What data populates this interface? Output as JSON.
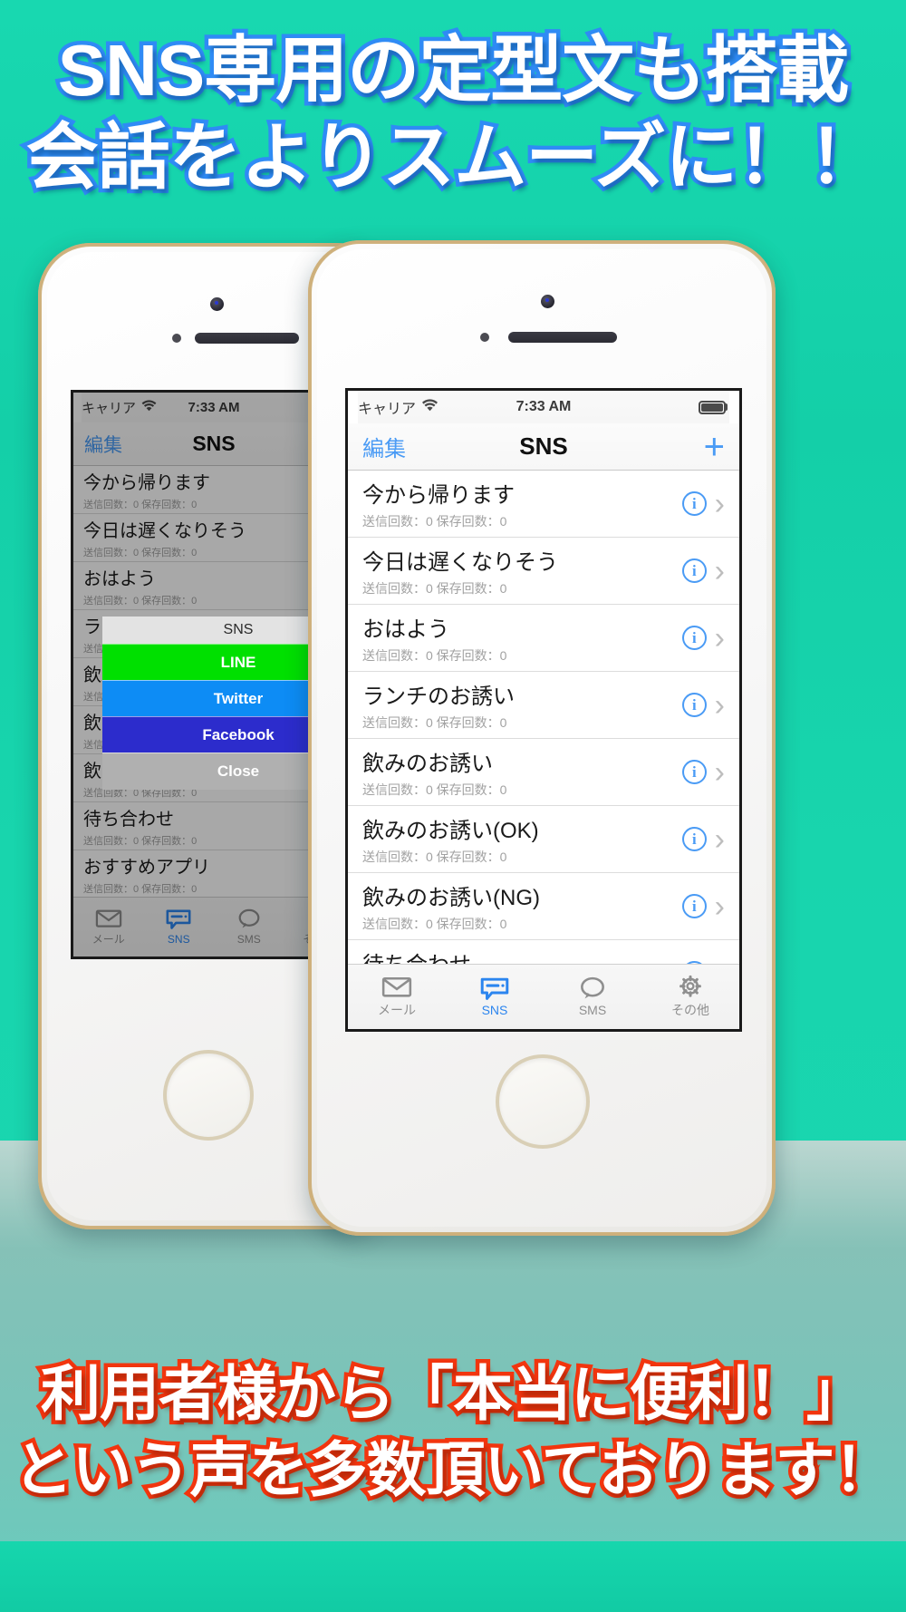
{
  "headline": {
    "line1": "SNS専用の定型文も搭載",
    "line2": "会話をよりスムーズに！！",
    "text_color": "#ffffff",
    "outline_color": "#2f8bf5"
  },
  "caption": {
    "line1": "利用者様から「本当に便利！」",
    "line2": "という声を多数頂いております！",
    "text_color": "#ffffff",
    "outline_color": "#f2350e"
  },
  "background": {
    "top_color": "#18d8b0",
    "bottom_band_color": "#16d6ad",
    "table_color": "#96bdb8"
  },
  "app": {
    "status_bar": {
      "carrier": "キャリア",
      "wifi_icon": "wifi-icon",
      "time": "7:33 AM",
      "battery_icon": "battery-icon"
    },
    "nav_bar": {
      "edit_label": "編集",
      "title": "SNS",
      "add_label": "+",
      "tint_color": "#4a9bf5"
    },
    "list": {
      "subtitle_template": "送信回数：0 保存回数：0",
      "info_icon": "info-circle-icon",
      "chevron_icon": "chevron-right-icon",
      "rows": [
        {
          "title": "今から帰ります",
          "subtitle": "送信回数：0 保存回数：0"
        },
        {
          "title": "今日は遅くなりそう",
          "subtitle": "送信回数：0 保存回数：0"
        },
        {
          "title": "おはよう",
          "subtitle": "送信回数：0 保存回数：0"
        },
        {
          "title": "ランチのお誘い",
          "subtitle": "送信回数：0 保存回数：0"
        },
        {
          "title": "飲みのお誘い",
          "subtitle": "送信回数：0 保存回数：0"
        },
        {
          "title": "飲みのお誘い(OK)",
          "subtitle": "送信回数：0 保存回数：0"
        },
        {
          "title": "飲みのお誘い(NG)",
          "subtitle": "送信回数：0 保存回数：0"
        },
        {
          "title": "待ち合わせ",
          "subtitle": "送信回数：0 保存回数：0"
        },
        {
          "title": "おすすめアプリ",
          "subtitle": "送信回数：0 保存回数：0"
        }
      ]
    },
    "tab_bar": {
      "active_index": 1,
      "active_color": "#2b85ef",
      "inactive_color": "#8e8e8e",
      "tabs": [
        {
          "label": "メール",
          "icon": "envelope-icon"
        },
        {
          "label": "SNS",
          "icon": "speech-bubble-icon"
        },
        {
          "label": "SMS",
          "icon": "oval-bubble-icon"
        },
        {
          "label": "その他",
          "icon": "gear-icon"
        }
      ]
    },
    "action_sheet": {
      "header": "SNS",
      "options": [
        {
          "label": "LINE",
          "color": "#00e000"
        },
        {
          "label": "Twitter",
          "color": "#0d8cf5"
        },
        {
          "label": "Facebook",
          "color": "#2c2ccc"
        }
      ],
      "close_label": "Close",
      "close_color": "#b0b0b0"
    }
  }
}
